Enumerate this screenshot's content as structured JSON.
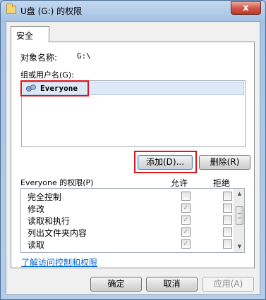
{
  "window": {
    "title": "U盘 (G:) 的权限",
    "close_label": "x"
  },
  "tabs": [
    {
      "label": "安全"
    }
  ],
  "object": {
    "label": "对象名称:",
    "value": "G:\\"
  },
  "groups": {
    "label": "组或用户名(G):",
    "items": [
      {
        "label": "Everyone",
        "selected": true
      }
    ]
  },
  "buttons": {
    "add": "添加(D)...",
    "remove": "删除(R)"
  },
  "permissions": {
    "title": "Everyone 的权限(P)",
    "allow_header": "允许",
    "deny_header": "拒绝",
    "rows": [
      {
        "name": "完全控制",
        "allow": false,
        "deny": false
      },
      {
        "name": "修改",
        "allow": true,
        "deny": false
      },
      {
        "name": "读取和执行",
        "allow": true,
        "deny": false
      },
      {
        "name": "列出文件夹内容",
        "allow": true,
        "deny": false
      },
      {
        "name": "读取",
        "allow": true,
        "deny": false
      }
    ]
  },
  "help_link": "了解访问控制和权限",
  "footer": {
    "ok": "确定",
    "cancel": "取消",
    "apply": "应用(A)"
  },
  "colors": {
    "highlight_box": "#e0141a",
    "link": "#0066cc"
  },
  "icons": {
    "folder": "folder-icon",
    "users": "users-icon",
    "check": "✓"
  }
}
